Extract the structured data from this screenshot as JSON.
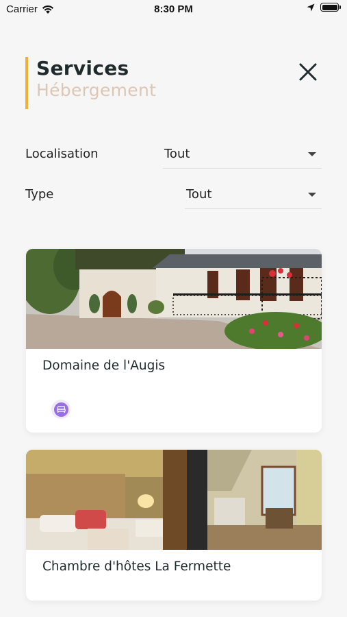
{
  "status_bar": {
    "carrier": "Carrier",
    "time": "8:30 PM"
  },
  "header": {
    "title": "Services",
    "subtitle": "Hébergement",
    "accent_color": "#f1b02f",
    "subtitle_color": "#ddc7b4"
  },
  "filters": [
    {
      "label": "Localisation",
      "value": "Tout"
    },
    {
      "label": "Type",
      "value": "Tout"
    }
  ],
  "listings": [
    {
      "name": "Domaine de l'Augis",
      "amenity_icon": "bed-icon",
      "amenity_color": "#9a6fe6"
    },
    {
      "name": "Chambre d'hôtes La Fermette"
    }
  ]
}
